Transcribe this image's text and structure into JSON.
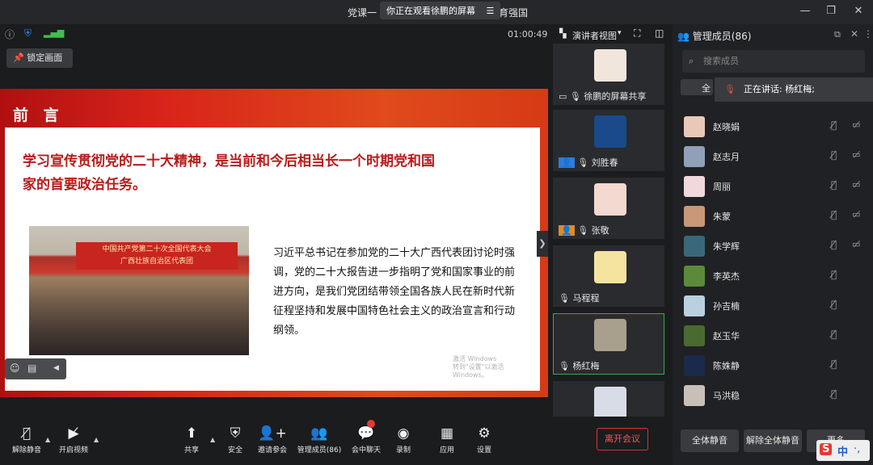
{
  "window": {
    "title_prefix": "党课一",
    "title_suffix": "教育强国",
    "watching_badge": "你正在观看徐鹏的屏幕",
    "timer": "01:00:49",
    "lock_button": "锁定画面",
    "menu_icon": "menu-icon",
    "min_icon": "minimize-icon",
    "max_icon": "maximize-icon",
    "close_icon": "close-icon"
  },
  "slide": {
    "heading": "前 言",
    "headline": "学习宣传贯彻党的二十大精神，是当前和今后相当长一个时期党和国家的首要政治任务。",
    "banner_line1": "中国共产党第二十次全国代表大会",
    "banner_line2": "广西壮族自治区代表团",
    "body": "习近平总书记在参加党的二十大广西代表团讨论时强调，党的二十大报告进一步指明了党和国家事业的前进方向，是我们党团结带领全国各族人民在新时代新征程坚持和发展中国特色社会主义的政治宣言和行动纲领。",
    "watermark_line1": "激活 Windows",
    "watermark_line2": "转到\"设置\"以激活 Windows。"
  },
  "speaker_view": {
    "label": "演讲者视图"
  },
  "tiles": [
    {
      "name": "徐鹏的屏幕共享",
      "color": "#f0e6dc"
    },
    {
      "name": "刘胜春",
      "color": "#1a4a8a"
    },
    {
      "name": "张敬",
      "color": "#f4d9d0"
    },
    {
      "name": "马程程",
      "color": "#f5e3a0"
    },
    {
      "name": "杨红梅",
      "color": "#a8a08c"
    },
    {
      "name": "",
      "color": "#d8dce6"
    }
  ],
  "panel": {
    "title": "管理成员(86)",
    "search_placeholder": "搜索成员",
    "speaking": "正在讲话: 杨红梅;",
    "tab_partial": "全",
    "members": [
      {
        "name": "赵晓娟",
        "color": "#e8c8b8"
      },
      {
        "name": "赵志月",
        "color": "#8fa0b8"
      },
      {
        "name": "周丽",
        "color": "#f0d8dc"
      },
      {
        "name": "朱蒙",
        "color": "#c89878"
      },
      {
        "name": "朱学辉",
        "color": "#3a6878"
      },
      {
        "name": "李英杰",
        "color": "#5a8a3a"
      },
      {
        "name": "孙吉楠",
        "color": "#b8d0e0"
      },
      {
        "name": "赵玉华",
        "color": "#4a6a30"
      },
      {
        "name": "陈姝静",
        "color": "#1a2a4a"
      },
      {
        "name": "马洪稳",
        "color": "#c8c0b8"
      }
    ],
    "mute_all": "全体静音",
    "unmute_all": "解除全体静音",
    "more": "更多"
  },
  "toolbar": {
    "unmute": "解除静音",
    "start_video": "开启视频",
    "share": "共享",
    "security": "安全",
    "invite": "邀请参会",
    "manage": "管理成员(86)",
    "chat": "会中聊天",
    "record": "录制",
    "apps": "应用",
    "settings": "设置",
    "leave": "离开会议"
  },
  "ime": {
    "logo": "S",
    "lang": "中"
  }
}
